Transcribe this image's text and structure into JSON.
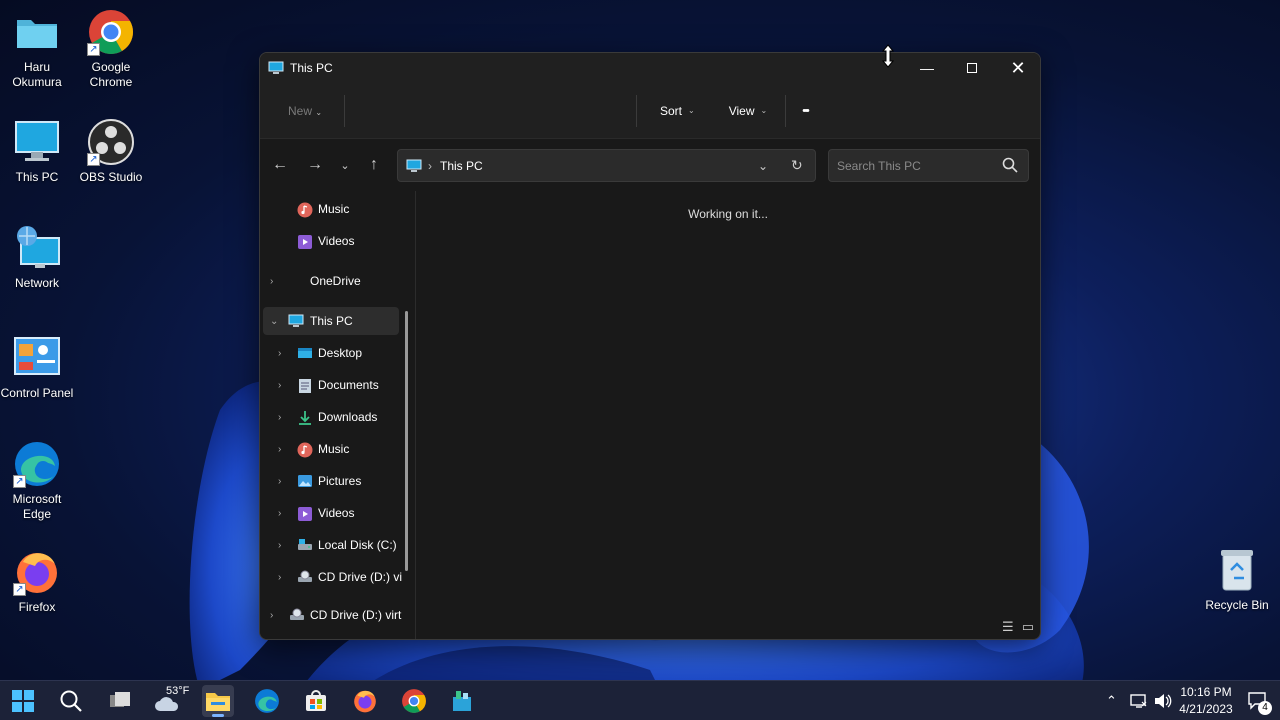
{
  "desktop": {
    "icons": [
      {
        "label": "Haru Okumura"
      },
      {
        "label": "Google Chrome"
      },
      {
        "label": "This PC"
      },
      {
        "label": "OBS Studio"
      },
      {
        "label": "Network"
      },
      {
        "label": "Control Panel"
      },
      {
        "label": "Microsoft Edge"
      },
      {
        "label": "Firefox"
      }
    ],
    "recycle_bin": "Recycle Bin"
  },
  "window": {
    "title": "This PC",
    "toolbar": {
      "new_label": "New",
      "sort_label": "Sort",
      "view_label": "View",
      "more_label": "•••"
    },
    "address": {
      "crumb": "This PC",
      "search_placeholder": "Search This PC"
    },
    "sidebar": {
      "items": [
        {
          "label": "Music",
          "icon": "music-icon"
        },
        {
          "label": "Videos",
          "icon": "videos-icon"
        },
        {
          "label": "OneDrive",
          "icon": "onedrive-icon"
        },
        {
          "label": "This PC",
          "icon": "this-pc-icon"
        },
        {
          "label": "Desktop",
          "icon": "desktop-folder-icon"
        },
        {
          "label": "Documents",
          "icon": "documents-icon"
        },
        {
          "label": "Downloads",
          "icon": "downloads-icon"
        },
        {
          "label": "Music",
          "icon": "music-icon"
        },
        {
          "label": "Pictures",
          "icon": "pictures-icon"
        },
        {
          "label": "Videos",
          "icon": "videos-icon"
        },
        {
          "label": "Local Disk (C:)",
          "icon": "local-disk-icon"
        },
        {
          "label": "CD Drive (D:) vi",
          "icon": "cd-drive-icon"
        },
        {
          "label": "CD Drive (D:) virt",
          "icon": "cd-drive-icon"
        }
      ]
    },
    "content_status": "Working on it..."
  },
  "taskbar": {
    "weather_temp": "53°F",
    "time": "10:16 PM",
    "date": "4/21/2023",
    "notification_count": "4"
  },
  "colors": {
    "accent": "#4cc2ff",
    "window_bg": "#191919",
    "taskbar_bg": "#1c2238"
  }
}
